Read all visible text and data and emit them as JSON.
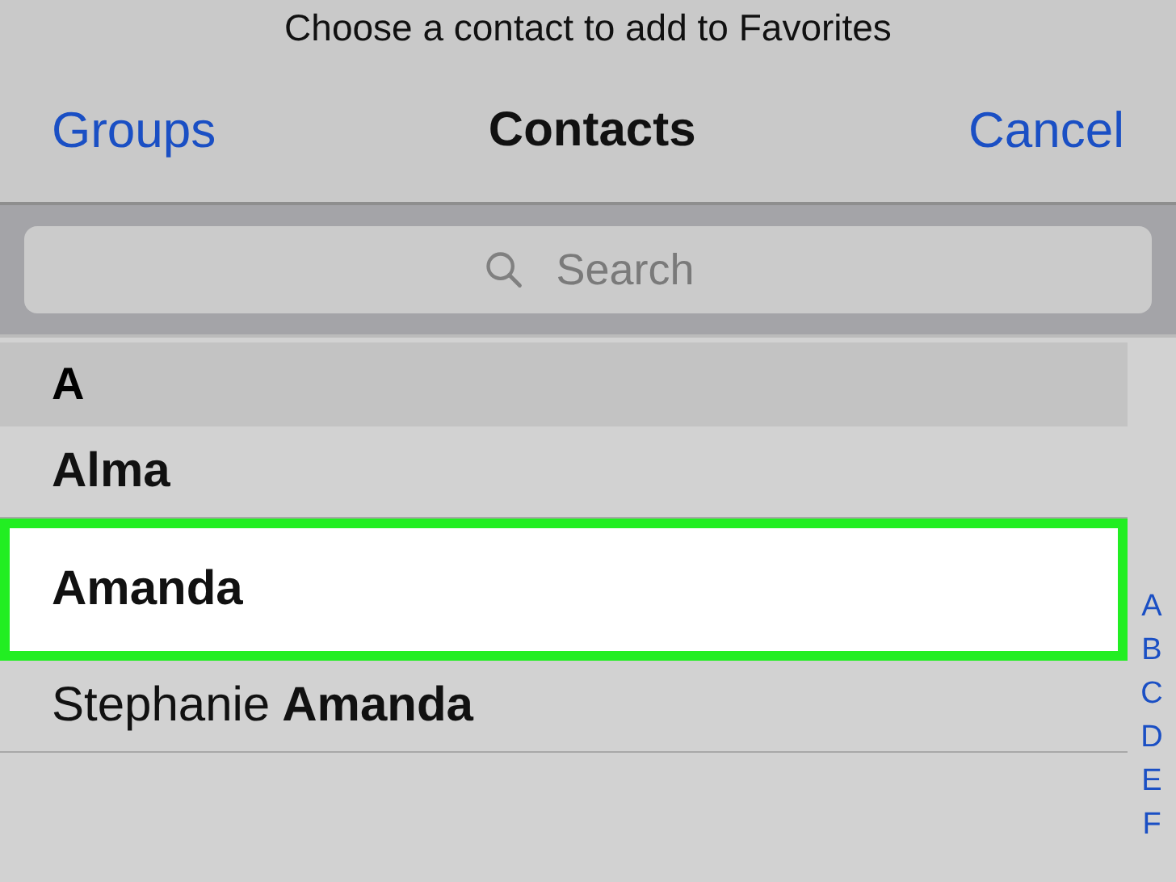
{
  "prompt": "Choose a contact to add to Favorites",
  "nav": {
    "left": "Groups",
    "title": "Contacts",
    "right": "Cancel"
  },
  "search": {
    "placeholder": "Search"
  },
  "section": "A",
  "contacts": [
    {
      "last": "Alma",
      "selected": false
    },
    {
      "last": "Amanda",
      "selected": true
    },
    {
      "first": "Stephanie",
      "last": "Amanda",
      "selected": false
    }
  ],
  "index": [
    "A",
    "B",
    "C",
    "D",
    "E",
    "F"
  ]
}
